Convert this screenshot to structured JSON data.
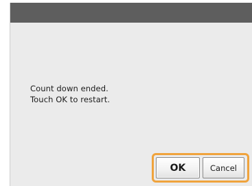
{
  "dialog": {
    "message_line1": "Count down ended.",
    "message_line2": "Touch OK to restart."
  },
  "buttons": {
    "ok_label": "OK",
    "cancel_label": "Cancel"
  },
  "colors": {
    "titlebar": "#5e5e5e",
    "dialog_background": "#ebebeb",
    "focus_highlight": "#f0a33c"
  }
}
